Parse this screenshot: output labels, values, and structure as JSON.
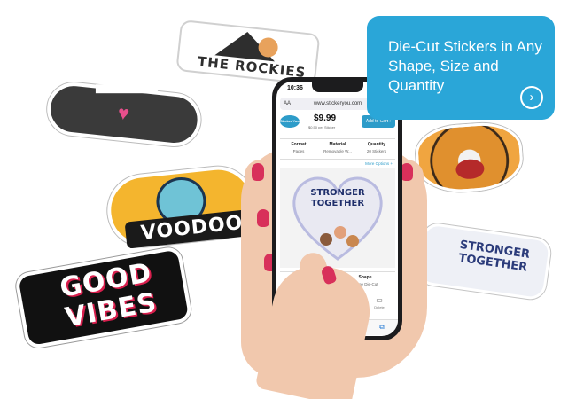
{
  "stickers": {
    "rockies": "THE ROCKIES",
    "voodoo": "VOODOO",
    "good_vibes": "GOOD VIBES",
    "stronger_right": "STRONGER TOGETHER"
  },
  "phone": {
    "status_time": "10:36",
    "status_icons": "▪▪▪ ◠ ▭",
    "url_aa": "AA",
    "url": "www.stickeryou.com",
    "logo_text": "Sticker You",
    "price": "$9.99",
    "price_sub": "$0.50 per Sticker",
    "add_to_cart": "Add to Cart ›",
    "options": [
      {
        "label": "Format",
        "value": "Pages"
      },
      {
        "label": "Material",
        "value": "Removable W..."
      },
      {
        "label": "Quantity",
        "value": "20 Stickers"
      }
    ],
    "more_options": "More Options +",
    "preview_text": "STRONGER TOGETHER",
    "size_label": "Size",
    "size_value": "",
    "shape_label": "Shape",
    "shape_value": "Image Die-Cut",
    "tools": [
      "Add Art",
      "Add Text",
      "Canvas",
      "Delete"
    ]
  },
  "callout": {
    "text": "Die-Cut Stickers in Any Shape, Size and Quantity",
    "button_icon": "chevron-right-icon"
  },
  "colors": {
    "callout_bg": "#2aa6d8",
    "brand_blue": "#2d9cc9",
    "nail_red": "#d8305a",
    "heart_pink": "#e84f8c"
  }
}
